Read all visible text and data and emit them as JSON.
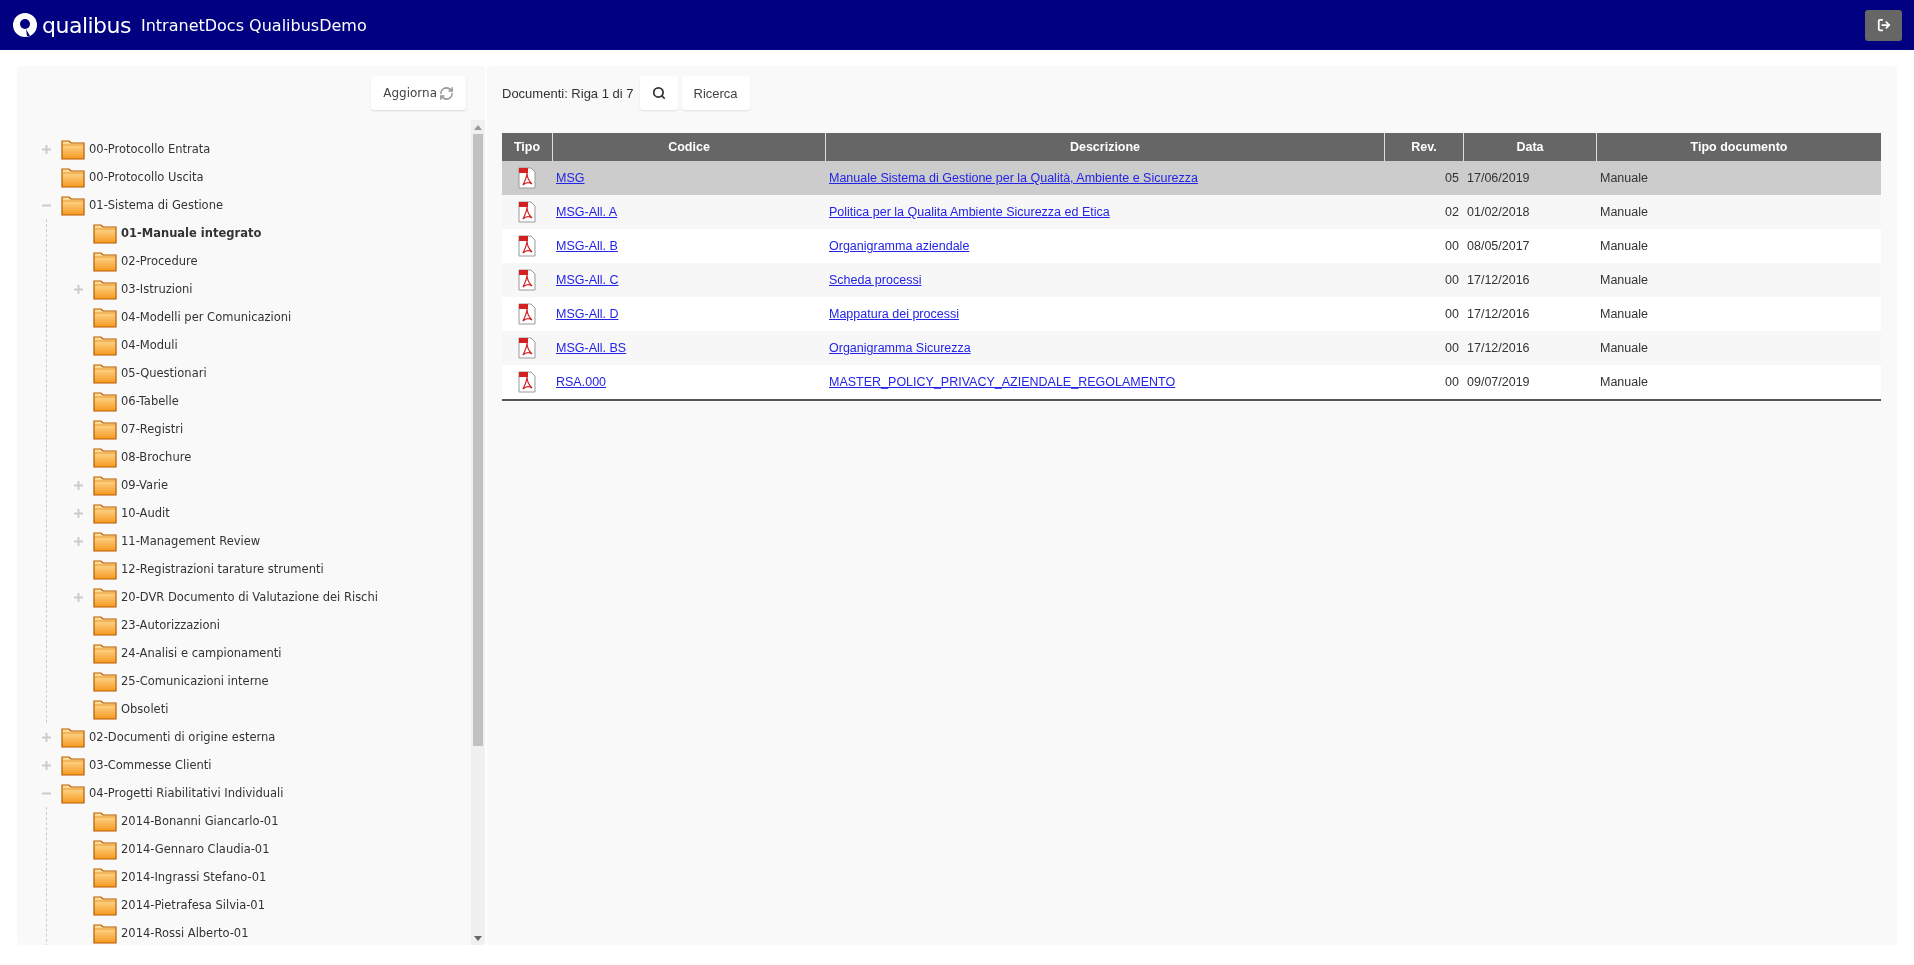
{
  "header": {
    "logo_text": "qualibus",
    "title": "IntranetDocs QualibusDemo"
  },
  "tree": {
    "refresh_button": "Aggiorna",
    "items": [
      {
        "label": "00-Protocollo Entrata",
        "kind": "collapsed",
        "selected": false
      },
      {
        "label": "00-Protocollo Uscita",
        "kind": "leaf",
        "selected": false
      },
      {
        "label": "01-Sistema di Gestione",
        "kind": "expanded",
        "selected": false,
        "children": [
          {
            "label": "01-Manuale integrato",
            "kind": "leaf",
            "selected": true
          },
          {
            "label": "02-Procedure",
            "kind": "leaf",
            "selected": false
          },
          {
            "label": "03-Istruzioni",
            "kind": "collapsed",
            "selected": false
          },
          {
            "label": "04-Modelli per Comunicazioni",
            "kind": "leaf",
            "selected": false
          },
          {
            "label": "04-Moduli",
            "kind": "leaf",
            "selected": false
          },
          {
            "label": "05-Questionari",
            "kind": "leaf",
            "selected": false
          },
          {
            "label": "06-Tabelle",
            "kind": "leaf",
            "selected": false
          },
          {
            "label": "07-Registri",
            "kind": "leaf",
            "selected": false
          },
          {
            "label": "08-Brochure",
            "kind": "leaf",
            "selected": false
          },
          {
            "label": "09-Varie",
            "kind": "collapsed",
            "selected": false
          },
          {
            "label": "10-Audit",
            "kind": "collapsed",
            "selected": false
          },
          {
            "label": "11-Management Review",
            "kind": "collapsed",
            "selected": false
          },
          {
            "label": "12-Registrazioni tarature strumenti",
            "kind": "leaf",
            "selected": false
          },
          {
            "label": "20-DVR Documento di Valutazione dei Rischi",
            "kind": "collapsed",
            "selected": false
          },
          {
            "label": "23-Autorizzazioni",
            "kind": "leaf",
            "selected": false
          },
          {
            "label": "24-Analisi e campionamenti",
            "kind": "leaf",
            "selected": false
          },
          {
            "label": "25-Comunicazioni interne",
            "kind": "leaf",
            "selected": false
          },
          {
            "label": "Obsoleti",
            "kind": "leaf",
            "selected": false
          }
        ]
      },
      {
        "label": "02-Documenti di origine esterna",
        "kind": "collapsed",
        "selected": false
      },
      {
        "label": "03-Commesse Clienti",
        "kind": "collapsed",
        "selected": false
      },
      {
        "label": "04-Progetti Riabilitativi Individuali",
        "kind": "expanded",
        "selected": false,
        "children": [
          {
            "label": "2014-Bonanni Giancarlo-01",
            "kind": "leaf",
            "selected": false
          },
          {
            "label": "2014-Gennaro Claudia-01",
            "kind": "leaf",
            "selected": false
          },
          {
            "label": "2014-Ingrassi Stefano-01",
            "kind": "leaf",
            "selected": false
          },
          {
            "label": "2014-Pietrafesa Silvia-01",
            "kind": "leaf",
            "selected": false
          },
          {
            "label": "2014-Rossi Alberto-01",
            "kind": "leaf",
            "selected": false
          }
        ]
      }
    ]
  },
  "documents": {
    "status": "Documenti: Riga 1 di 7",
    "search_button": "Ricerca",
    "columns": [
      "Tipo",
      "Codice",
      "Descrizione",
      "Rev.",
      "Data",
      "Tipo documento"
    ],
    "rows": [
      {
        "kind": "pdf",
        "code": "MSG",
        "description": "Manuale Sistema di Gestione per la Qualità, Ambiente e Sicurezza",
        "rev": "05",
        "date": "17/06/2019",
        "doc_type": "Manuale",
        "selected": true
      },
      {
        "kind": "pdf",
        "code": "MSG-All. A",
        "description": "Politica per la Qualita Ambiente Sicurezza ed Etica",
        "rev": "02",
        "date": "01/02/2018",
        "doc_type": "Manuale",
        "selected": false
      },
      {
        "kind": "pdf",
        "code": "MSG-All. B",
        "description": "Organigramma aziendale",
        "rev": "00",
        "date": "08/05/2017",
        "doc_type": "Manuale",
        "selected": false
      },
      {
        "kind": "pdf",
        "code": "MSG-All. C",
        "description": "Scheda processi",
        "rev": "00",
        "date": "17/12/2016",
        "doc_type": "Manuale",
        "selected": false
      },
      {
        "kind": "pdf",
        "code": "MSG-All. D",
        "description": "Mappatura dei processi",
        "rev": "00",
        "date": "17/12/2016",
        "doc_type": "Manuale",
        "selected": false
      },
      {
        "kind": "pdf",
        "code": "MSG-All. BS",
        "description": "Organigramma Sicurezza",
        "rev": "00",
        "date": "17/12/2016",
        "doc_type": "Manuale",
        "selected": false
      },
      {
        "kind": "pdf",
        "code": "RSA.000",
        "description": "MASTER_POLICY_PRIVACY_AZIENDALE_REGOLAMENTO",
        "rev": "00",
        "date": "09/07/2019",
        "doc_type": "Manuale",
        "selected": false
      }
    ]
  }
}
